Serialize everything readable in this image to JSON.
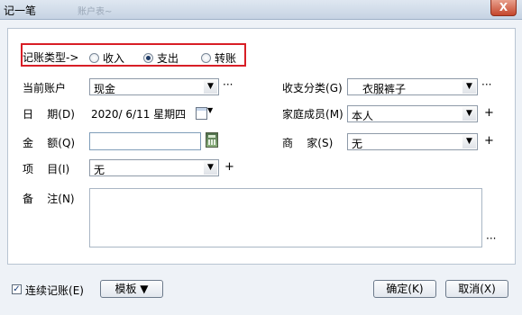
{
  "window": {
    "title": "记一笔",
    "ghost_text": "账户表~",
    "close_label": "X"
  },
  "type_row": {
    "label": "记账类型->",
    "options": [
      {
        "label": "收入",
        "selected": false
      },
      {
        "label": "支出",
        "selected": true
      },
      {
        "label": "转账",
        "selected": false
      }
    ]
  },
  "fields": {
    "account": {
      "label": "当前账户",
      "value": "现金",
      "more": "···"
    },
    "date": {
      "label": "日    期",
      "shortcut": "(D)",
      "value": "2020/ 6/11 星期四"
    },
    "amount": {
      "label": "金    额",
      "shortcut": "(Q)",
      "value": ""
    },
    "project": {
      "label": "项    目",
      "shortcut": "(I)",
      "value": "无",
      "add": "+"
    },
    "note": {
      "label": "备    注",
      "shortcut": "(N)",
      "value": "",
      "more": "···"
    },
    "category": {
      "label": "收支分类",
      "shortcut": "(G)",
      "value": "衣服裤子",
      "more": "···"
    },
    "member": {
      "label": "家庭成员",
      "shortcut": "(M)",
      "value": "本人",
      "add": "+"
    },
    "merchant": {
      "label": "商    家",
      "shortcut": "(S)",
      "value": "无",
      "add": "+"
    }
  },
  "footer": {
    "continuous": {
      "label": "连续记账",
      "shortcut": "(E)",
      "checked": true
    },
    "template_button": "模板 ▼",
    "ok_button": "确定(K)",
    "cancel_button": "取消(X)"
  }
}
